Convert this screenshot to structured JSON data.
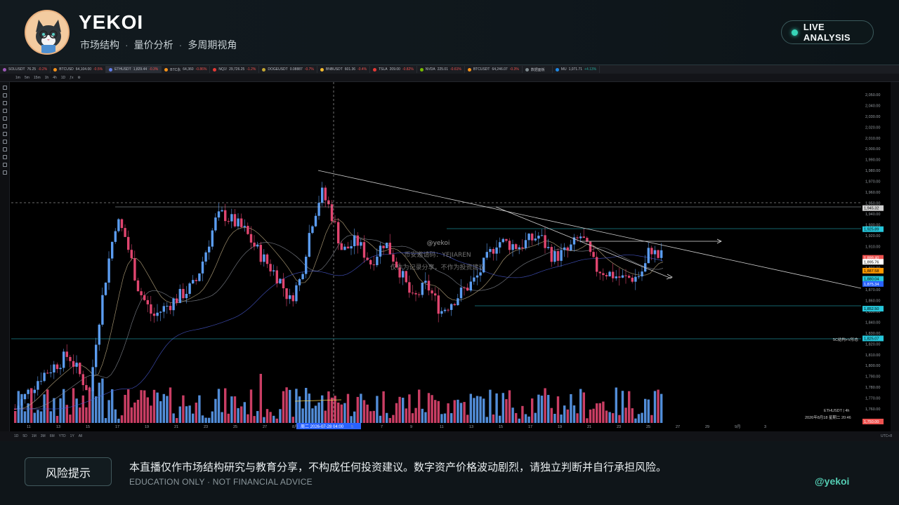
{
  "header": {
    "brand": "YEKOI",
    "subtitle": [
      "市场结构",
      "量价分析",
      "多周期视角"
    ],
    "subtitle_sep": "·",
    "live_label": "LIVE ANALYSIS",
    "live_dot_color": "#37d5b8"
  },
  "screen": {
    "tabs": [
      {
        "sym": "SOLUSDT",
        "price": "76.25",
        "chg": "-0.2%",
        "dir": "dn",
        "color": "#9b59b6"
      },
      {
        "sym": "BTCUSD",
        "price": "64,104.00",
        "chg": "-0.5%",
        "dir": "dn",
        "color": "#f7931a"
      },
      {
        "sym": "ETHUSDT",
        "price": "1,829.44",
        "chg": "-0.3%",
        "dir": "dn",
        "color": "#627eea"
      },
      {
        "sym": "BTC永",
        "price": "64,360",
        "chg": "-0.86%",
        "dir": "dn",
        "color": "#f7931a"
      },
      {
        "sym": "NQ1!",
        "price": "29,726.25",
        "chg": "-1.2%",
        "dir": "dn",
        "color": "#e53935"
      },
      {
        "sym": "DOGEUSDT",
        "price": "0.08887",
        "chg": "-0.7%",
        "dir": "dn",
        "color": "#c2a633"
      },
      {
        "sym": "BNBUSDT",
        "price": "601.36",
        "chg": "-0.4%",
        "dir": "dn",
        "color": "#f3ba2f"
      },
      {
        "sym": "TSLA",
        "price": "209.00",
        "chg": "-0.82%",
        "dir": "dn",
        "color": "#e53935"
      },
      {
        "sym": "NVDA",
        "price": "225.01",
        "chg": "-0.61%",
        "dir": "dn",
        "color": "#76b900"
      },
      {
        "sym": "BTCUSDT",
        "price": "64,246.07",
        "chg": "-0.3%",
        "dir": "dn",
        "color": "#f7931a"
      },
      {
        "sym": "数据面板",
        "price": "",
        "chg": "",
        "dir": "up",
        "color": "#7f8b90"
      },
      {
        "sym": "MU",
        "price": "1,071.71",
        "chg": "+4.13%",
        "dir": "up",
        "color": "#1e88e5"
      }
    ],
    "watermark_handle": "@yekoi",
    "watermark_line1": "币安邀请码：YEJIAREN",
    "watermark_line2": "仅作为记录分享，不作为投资建议",
    "crosshair_label": "周二 2026-07-28  04:00",
    "line_annotation": "5C结构+V形态",
    "legend_text": "ETHUSDT | 4h",
    "date_text": "2026年8月18 星期二 20:46",
    "timezone": "UTC+8",
    "price_levels": [
      "2,050.00",
      "2,040.00",
      "2,030.00",
      "2,020.00",
      "2,010.00",
      "2,000.00",
      "1,990.00",
      "1,980.00",
      "1,970.00",
      "1,960.00",
      "1,950.00",
      "1,940.00",
      "1,930.00",
      "1,920.00",
      "1,910.00",
      "1,900.00",
      "1,890.00",
      "1,880.00",
      "1,870.00",
      "1,860.00",
      "1,850.00",
      "1,840.00",
      "1,830.00",
      "1,820.00",
      "1,810.00",
      "1,800.00",
      "1,790.00",
      "1,780.00",
      "1,770.00",
      "1,760.00"
    ],
    "price_tags": [
      {
        "label": "1,945.32",
        "color": "#d0d0d0",
        "text": "#000"
      },
      {
        "label": "1,925.89",
        "color": "#26c6da",
        "text": "#000"
      },
      {
        "label": "1,899.40",
        "color": "#ef5350",
        "text": "#fff"
      },
      {
        "label": "1,895.76",
        "color": "#ffffff",
        "text": "#000"
      },
      {
        "label": "1,887.58",
        "color": "#ff9800",
        "text": "#000"
      },
      {
        "label": "1,880.04",
        "color": "#26c6da",
        "text": "#000"
      },
      {
        "label": "1,875.34",
        "color": "#2962ff",
        "text": "#fff"
      },
      {
        "label": "1,852.50",
        "color": "#26c6da",
        "text": "#000"
      },
      {
        "label": "1,825.07",
        "color": "#26c6da",
        "text": "#000"
      },
      {
        "label": "1,750.00",
        "color": "#ef5350",
        "text": "#fff"
      }
    ],
    "x_labels": [
      "11",
      "13",
      "15",
      "17",
      "19",
      "21",
      "23",
      "25",
      "27",
      "8月",
      "3",
      "5",
      "7",
      "9",
      "11",
      "13",
      "15",
      "17",
      "19",
      "21",
      "23",
      "25",
      "27",
      "29",
      "9月",
      "3"
    ]
  },
  "footer": {
    "risk_label": "风险提示",
    "disclaimer": "本直播仅作市场结构研究与教育分享，不构成任何投资建议。数字资产价格波动剧烈，请独立判断并自行承担风险。",
    "edu": "EDUCATION ONLY  ·  NOT FINANCIAL ADVICE",
    "handle": "@yekoi"
  },
  "colors": {
    "up": "#5b9cf0",
    "down": "#e0456f",
    "accent": "#37d5b8"
  }
}
